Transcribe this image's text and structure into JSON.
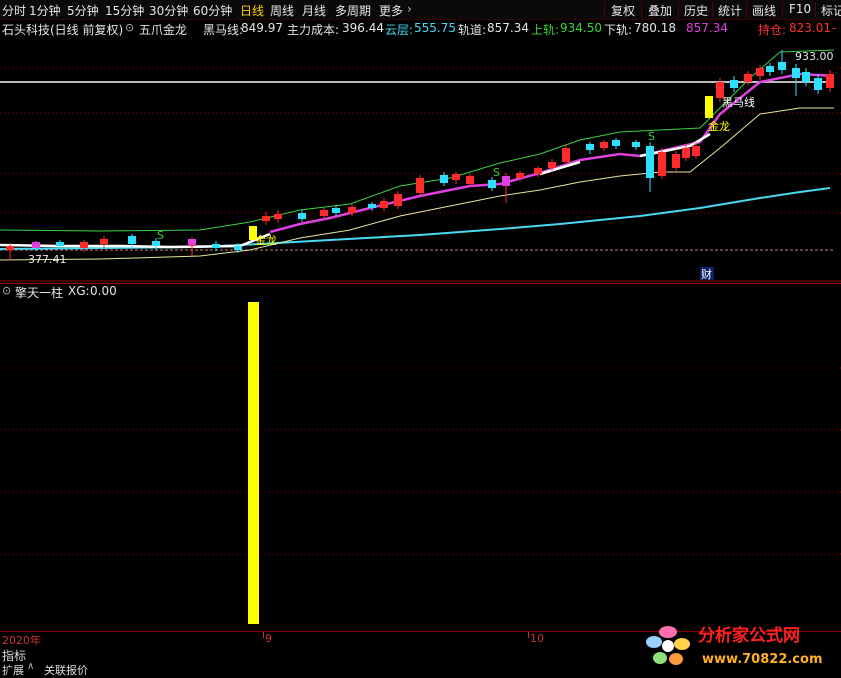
{
  "topbar": {
    "left": [
      "分时",
      "1分钟",
      "5分钟",
      "15分钟",
      "30分钟",
      "60分钟",
      "日线",
      "周线",
      "月线",
      "多周期",
      "更多"
    ],
    "selected": "日线",
    "right": [
      "复权",
      "叠加",
      "历史",
      "统计",
      "画线",
      "F10",
      "标记"
    ]
  },
  "info": {
    "stock": "石头科技(日线 前复权)",
    "indicator": "五爪金龙",
    "items": [
      {
        "label": "黑马线:",
        "value": "849.97",
        "color": "#e6e6e6"
      },
      {
        "label": "主力成本:",
        "value": "396.44",
        "color": "#e6e6e6"
      },
      {
        "label": "云层:",
        "value": "555.75",
        "color": "#46d9f0"
      },
      {
        "label": "轨道:",
        "value": "857.34",
        "color": "#e6e6e6"
      },
      {
        "label": "上轨:",
        "value": "934.50",
        "color": "#3cd23c"
      },
      {
        "label": "下轨:",
        "value": "780.18",
        "color": "#e6e6e6"
      },
      {
        "label": "",
        "value": "857.34",
        "color": "#e040e0"
      },
      {
        "label": "持仓:",
        "value": "823.01",
        "color": "#ff3030"
      }
    ]
  },
  "chart_labels": {
    "high": "933.00",
    "low": "377.41",
    "jinlong1": "金龙",
    "jinlong2": "金龙",
    "heima": "黑马线",
    "s_mark": "S",
    "cai": "财"
  },
  "sub": {
    "title": "擎天一柱",
    "xg_label": "XG:",
    "xg_value": "0.00"
  },
  "xaxis": [
    "2020年",
    "9",
    "10"
  ],
  "bottom": {
    "label1": "指标",
    "tab1": "扩展",
    "tab2": "关联报价"
  },
  "logo": {
    "line1": "分析家公式网",
    "line2": "www.70822.com"
  },
  "colors": {
    "up": "#ff2a2a",
    "down": "#2ee0ff",
    "ma_white": "#ffffff",
    "ma_magenta": "#e040e0",
    "upper_green": "#3cd23c",
    "lower_yellow": "#e6e6a0",
    "cloud_cyan": "#46d9f0",
    "pillar": "#ffff00",
    "grid": "#8a0000"
  }
}
